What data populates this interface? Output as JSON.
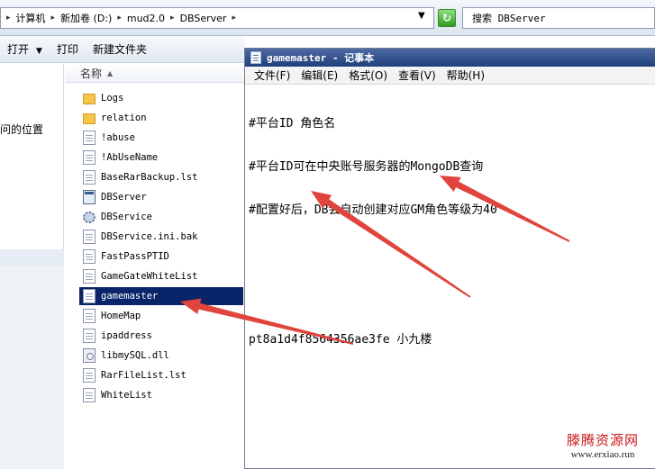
{
  "address_bar": {
    "crumbs": [
      "计算机",
      "新加卷 (D:)",
      "mud2.0",
      "DBServer"
    ],
    "search_placeholder": "搜索 DBServer"
  },
  "toolbar": {
    "open_label": "打开",
    "print_label": "打印",
    "new_folder_label": "新建文件夹"
  },
  "nav_pane": {
    "visible_text": "问的位置"
  },
  "file_list": {
    "column_name": "名称",
    "files": [
      {
        "name": "Logs",
        "icon": "folder-icon"
      },
      {
        "name": "relation",
        "icon": "folder-icon"
      },
      {
        "name": "!abuse",
        "icon": "document-icon"
      },
      {
        "name": "!AbUseName",
        "icon": "document-icon"
      },
      {
        "name": "BaseRarBackup.lst",
        "icon": "document-icon"
      },
      {
        "name": "DBServer",
        "icon": "application-icon"
      },
      {
        "name": "DBService",
        "icon": "gear-icon"
      },
      {
        "name": "DBService.ini.bak",
        "icon": "document-icon"
      },
      {
        "name": "FastPassPTID",
        "icon": "document-icon"
      },
      {
        "name": "GameGateWhiteList",
        "icon": "document-icon"
      },
      {
        "name": "gamemaster",
        "icon": "document-icon",
        "selected": true
      },
      {
        "name": "HomeMap",
        "icon": "document-icon"
      },
      {
        "name": "ipaddress",
        "icon": "document-icon"
      },
      {
        "name": "libmySQL.dll",
        "icon": "dll-icon"
      },
      {
        "name": "RarFileList.lst",
        "icon": "document-icon"
      },
      {
        "name": "WhiteList",
        "icon": "document-icon"
      }
    ]
  },
  "notepad": {
    "title": "gamemaster - 记事本",
    "menu": [
      "文件(F)",
      "编辑(E)",
      "格式(O)",
      "查看(V)",
      "帮助(H)"
    ],
    "lines": [
      "#平台ID 角色名",
      "#平台ID可在中央账号服务器的MongoDB查询",
      "#配置好后，DB会自动创建对应GM角色等级为40",
      "",
      "",
      "pt8a1d4f8564356ae3fe 小九楼"
    ]
  },
  "annotation_color": "#e0443c",
  "watermark": {
    "name": "滕腾资源网",
    "url": "www.erxiao.run"
  }
}
